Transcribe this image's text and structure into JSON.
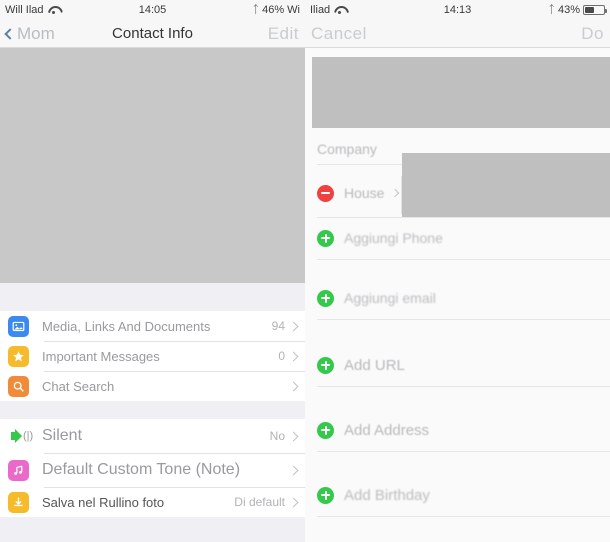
{
  "left_panel": {
    "statusbar": {
      "carrier": "Will Ilad",
      "wifi_icon": "wifi-icon",
      "time": "14:05",
      "bluetooth_icon": "bluetooth-icon",
      "battery_text": "46% Wi",
      "battery_icon": "battery-icon"
    },
    "navbar": {
      "back_label": "Mom",
      "back_icon": "chevron-left-icon",
      "title": "Contact Info",
      "action_label": "Edit"
    },
    "hero_redaction": "redacted-contact-photo",
    "groups": [
      {
        "rows": [
          {
            "icon": "media-photo-icon",
            "icon_color": "#3a8af0",
            "label": "Media, Links And Documents",
            "value": "94",
            "chevron": true
          },
          {
            "icon": "star-icon",
            "icon_color": "#f5bb2b",
            "label": "Important Messages",
            "value": "0",
            "chevron": true
          },
          {
            "icon": "search-icon",
            "icon_color": "#f08b3a",
            "label": "Chat Search",
            "value": "",
            "chevron": true
          }
        ]
      },
      {
        "rows": [
          {
            "icon": "speaker-icon",
            "icon_color": "#34c94a",
            "label": "Silent",
            "value": "No",
            "chevron": true
          },
          {
            "icon": "music-note-icon",
            "icon_color": "#e96ac8",
            "label": "Default Custom Tone (Note)",
            "value": "",
            "chevron": true
          },
          {
            "icon": "save-download-icon",
            "icon_color": "#f5bb2b",
            "label": "Salva nel Rullino foto",
            "value": "Di default",
            "chevron": true
          }
        ]
      }
    ]
  },
  "right_panel": {
    "statusbar": {
      "carrier": "Iliad",
      "wifi_icon": "wifi-icon",
      "time": "14:13",
      "bluetooth_icon": "bluetooth-icon",
      "battery_text": "43%",
      "battery_icon": "battery-icon"
    },
    "navbar": {
      "cancel_label": "Cancel",
      "done_label": "Do"
    },
    "hero_redaction": "redacted-contact-photo",
    "field_redaction": "redacted-phone-number",
    "fields": [
      {
        "name": "company-field",
        "label": "Company",
        "icon": "none"
      },
      {
        "name": "phone-label-house",
        "label": "House",
        "icon": "minus-icon",
        "icon_color": "#ef4141",
        "chevron": true
      },
      {
        "name": "add-phone",
        "label": "Aggiungi Phone",
        "icon": "plus-icon",
        "icon_color": "#34c94a"
      },
      {
        "name": "add-email",
        "label": "Aggiungi email",
        "icon": "plus-icon",
        "icon_color": "#34c94a"
      },
      {
        "name": "add-url",
        "label": "Add URL",
        "icon": "plus-icon",
        "icon_color": "#34c94a"
      },
      {
        "name": "add-address",
        "label": "Add Address",
        "icon": "plus-icon",
        "icon_color": "#34c94a"
      },
      {
        "name": "add-birthday",
        "label": "Add Birthday",
        "icon": "plus-icon",
        "icon_color": "#34c94a"
      }
    ]
  },
  "colors": {
    "accent_blue": "#3a8af0",
    "accent_green": "#34c94a",
    "accent_red": "#ef4141",
    "accent_yellow": "#f5bb2b",
    "accent_orange": "#f08b3a",
    "accent_pink": "#e96ac8",
    "redaction_gray": "#bfbfbf",
    "group_bg": "#efeff4"
  }
}
